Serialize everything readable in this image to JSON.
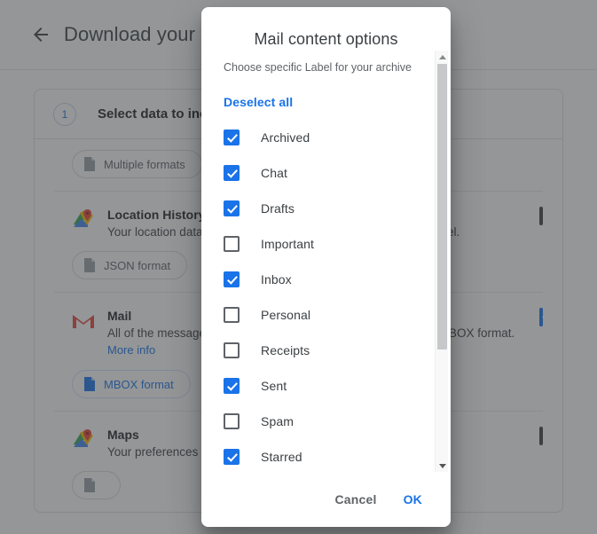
{
  "background": {
    "back_icon": "back-arrow-icon",
    "title": "Download your data",
    "step": {
      "number": "1",
      "title": "Select data to include"
    },
    "format_chip_top": {
      "icon": "document-icon",
      "label": "Multiple formats"
    },
    "rows": [
      {
        "icon": "google-maps-icon",
        "title": "Location History",
        "desc": "Your location data, including places you visit and routes you travel.",
        "link": "",
        "chip": {
          "icon": "document-icon",
          "label": "JSON format",
          "style": "grey"
        },
        "checked": false
      },
      {
        "icon": "gmail-icon",
        "title": "Mail",
        "desc": "All of the messages and attachments in your Gmail account in MBOX format.",
        "link": "More info",
        "chip": {
          "icon": "document-icon",
          "label": "MBOX format",
          "style": "blue"
        },
        "checked": true
      },
      {
        "icon": "google-maps-icon",
        "title": "Maps",
        "desc": "Your preferences and personal places in Maps",
        "link": "",
        "chip": null,
        "checked": false
      }
    ]
  },
  "dialog": {
    "title": "Mail content options",
    "subtitle": "Choose specific Label for your archive",
    "deselect_all": "Deselect all",
    "labels": [
      {
        "name": "Archived",
        "checked": true
      },
      {
        "name": "Chat",
        "checked": true
      },
      {
        "name": "Drafts",
        "checked": true
      },
      {
        "name": "Important",
        "checked": false
      },
      {
        "name": "Inbox",
        "checked": true
      },
      {
        "name": "Personal",
        "checked": false
      },
      {
        "name": "Receipts",
        "checked": false
      },
      {
        "name": "Sent",
        "checked": true
      },
      {
        "name": "Spam",
        "checked": false
      },
      {
        "name": "Starred",
        "checked": true
      }
    ],
    "scrollbar": {
      "up_icon": "scroll-up-arrow-icon",
      "down_icon": "scroll-down-arrow-icon"
    },
    "cancel_label": "Cancel",
    "ok_label": "OK"
  },
  "colors": {
    "accent": "#1a73e8",
    "text_primary": "#3c4043",
    "text_secondary": "#5f6368",
    "scrim": "rgba(60,64,67,0.55)"
  }
}
